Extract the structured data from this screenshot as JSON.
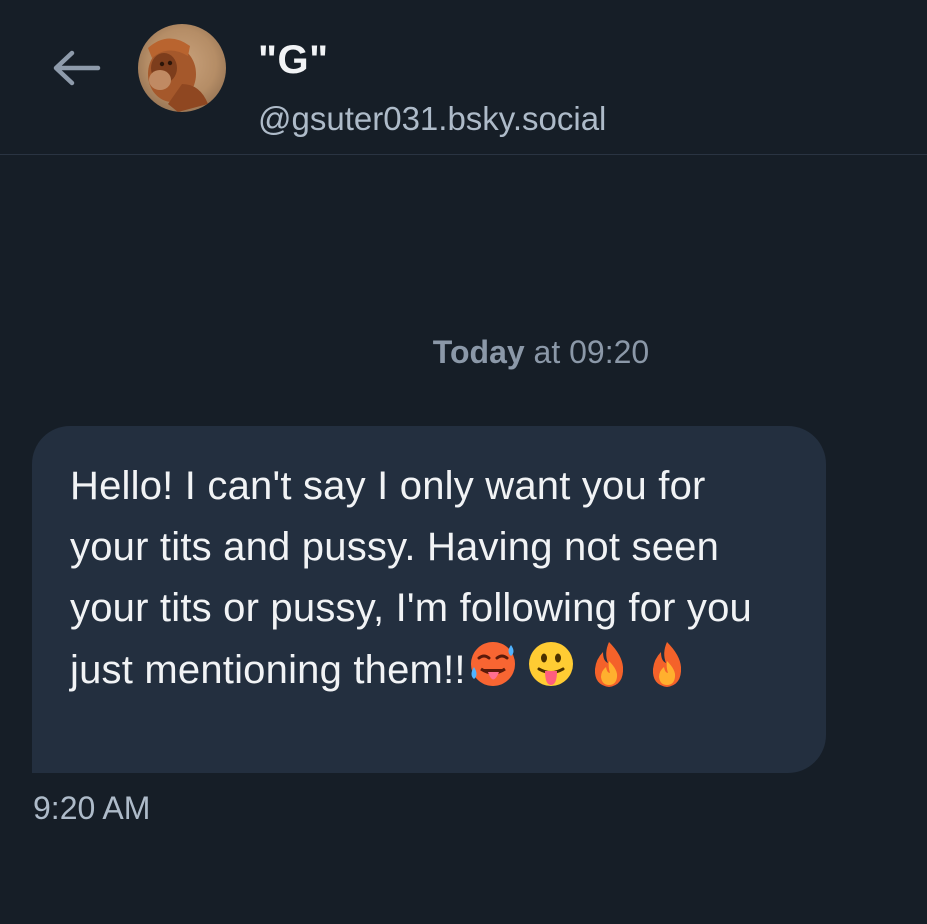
{
  "header": {
    "display_name": "\"G\"",
    "handle": "@gsuter031.bsky.social",
    "back_icon": "arrow-left-icon",
    "avatar_icon": "avatar"
  },
  "conversation": {
    "date_separator": {
      "day": "Today",
      "rest": " at 09:20"
    },
    "messages": [
      {
        "text": "Hello! I can't say I only want you for your tits and pussy. Having not seen your tits or pussy, I'm following for you just mentioning them!!",
        "emojis": [
          "hot-face-emoji",
          "tongue-out-emoji",
          "fire-emoji",
          "fire-emoji"
        ],
        "time": "9:20 AM"
      }
    ]
  },
  "colors": {
    "background": "#161e27",
    "bubble": "#232f3f",
    "text_primary": "#f1f3f5",
    "text_secondary": "#aebbc9",
    "text_muted": "#8b98a8",
    "divider": "#2a3442"
  }
}
